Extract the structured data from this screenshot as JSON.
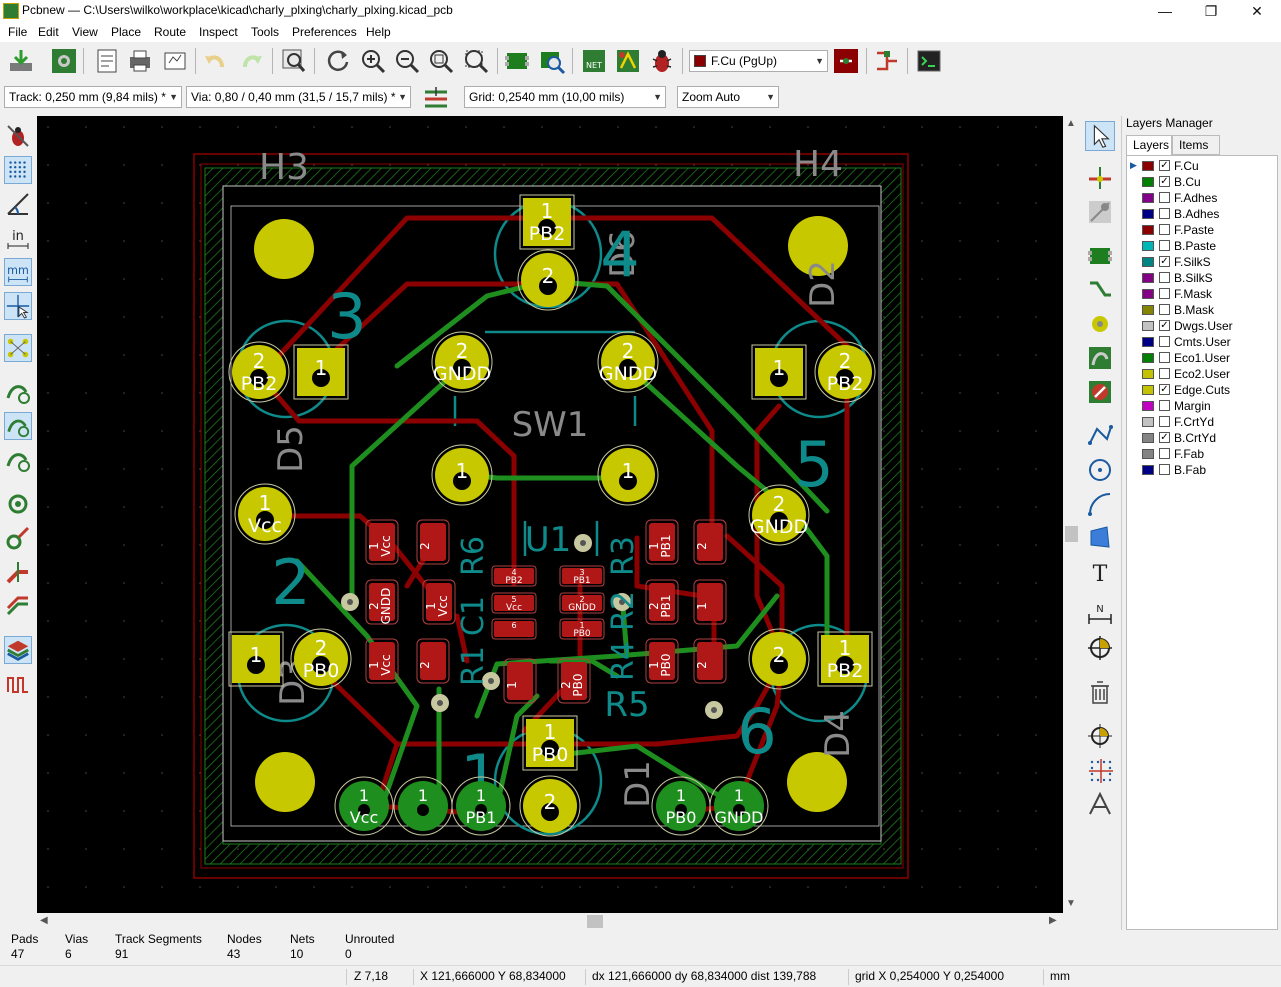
{
  "window": {
    "title": "Pcbnew — C:\\Users\\wilko\\workplace\\kicad\\charly_plxing\\charly_plxing.kicad_pcb",
    "controls": [
      "—",
      "❐",
      "✕"
    ]
  },
  "menu": [
    "File",
    "Edit",
    "View",
    "Place",
    "Route",
    "Inspect",
    "Tools",
    "Preferences",
    "Help"
  ],
  "toolbar": {
    "layer_select": "F.Cu (PgUp)"
  },
  "toolbar2": {
    "track": "Track: 0,250 mm (9,84 mils) *",
    "via": "Via: 0,80 / 0,40 mm (31,5 / 15,7 mils) *",
    "grid": "Grid: 0,2540 mm (10,00 mils)",
    "zoom": "Zoom Auto"
  },
  "layers_manager": {
    "title": "Layers Manager",
    "tabs": [
      "Layers",
      "Items"
    ],
    "layers": [
      {
        "name": "F.Cu",
        "color": "#8b0000",
        "checked": true
      },
      {
        "name": "B.Cu",
        "color": "#008000",
        "checked": true
      },
      {
        "name": "F.Adhes",
        "color": "#84008b",
        "checked": false
      },
      {
        "name": "B.Adhes",
        "color": "#000084",
        "checked": false
      },
      {
        "name": "F.Paste",
        "color": "#8b0000",
        "checked": false
      },
      {
        "name": "B.Paste",
        "color": "#00b5b5",
        "checked": false
      },
      {
        "name": "F.SilkS",
        "color": "#008484",
        "checked": true
      },
      {
        "name": "B.SilkS",
        "color": "#840084",
        "checked": false
      },
      {
        "name": "F.Mask",
        "color": "#840084",
        "checked": false
      },
      {
        "name": "B.Mask",
        "color": "#848400",
        "checked": false
      },
      {
        "name": "Dwgs.User",
        "color": "#c2c2c2",
        "checked": true
      },
      {
        "name": "Cmts.User",
        "color": "#000084",
        "checked": false
      },
      {
        "name": "Eco1.User",
        "color": "#008000",
        "checked": false
      },
      {
        "name": "Eco2.User",
        "color": "#c2c200",
        "checked": false
      },
      {
        "name": "Edge.Cuts",
        "color": "#c2c200",
        "checked": true
      },
      {
        "name": "Margin",
        "color": "#c200c2",
        "checked": false
      },
      {
        "name": "F.CrtYd",
        "color": "#c2c2c2",
        "checked": false
      },
      {
        "name": "B.CrtYd",
        "color": "#848484",
        "checked": true
      },
      {
        "name": "F.Fab",
        "color": "#848484",
        "checked": false
      },
      {
        "name": "B.Fab",
        "color": "#000084",
        "checked": false
      }
    ]
  },
  "board": {
    "labels": {
      "h3": "H3",
      "h4": "H4",
      "sw1": "SW1",
      "u1": "U1",
      "r5": "R5",
      "d1": "D1",
      "d2": "D2",
      "d3": "D3",
      "d4": "D4",
      "d5": "D5",
      "d6": "D6",
      "n1": "1",
      "n2": "2",
      "n3": "3",
      "n4": "4",
      "n5": "5",
      "n6": "6",
      "r1": "R1",
      "r2": "R2",
      "r3": "R3",
      "r4": "R4",
      "r6": "R6",
      "c1": "C1"
    },
    "big_pads": [
      {
        "num": "1",
        "net": "PB2"
      },
      {
        "num": "2",
        "net": ""
      },
      {
        "num": "2",
        "net": "PB2"
      },
      {
        "num": "1",
        "net": ""
      },
      {
        "num": "2",
        "net": "GNDD"
      },
      {
        "num": "2",
        "net": "GNDD"
      },
      {
        "num": "1",
        "net": ""
      },
      {
        "num": "2",
        "net": "PB2"
      },
      {
        "num": "1",
        "net": ""
      },
      {
        "num": "1",
        "net": ""
      },
      {
        "num": "1",
        "net": "Vcc"
      },
      {
        "num": "2",
        "net": "GNDD"
      },
      {
        "num": "1",
        "net": ""
      },
      {
        "num": "2",
        "net": "PB0"
      },
      {
        "num": "2",
        "net": ""
      },
      {
        "num": "1",
        "net": "PB2"
      },
      {
        "num": "1",
        "net": "PB0"
      },
      {
        "num": "2",
        "net": ""
      }
    ],
    "conn_pads": [
      {
        "num": "1",
        "net": "Vcc"
      },
      {
        "num": "1",
        "net": ""
      },
      {
        "num": "1",
        "net": "PB1"
      },
      {
        "num": "1",
        "net": "PB0"
      },
      {
        "num": "1",
        "net": "GNDD"
      }
    ],
    "smd_pads": [
      {
        "num": "1",
        "net": "Vcc"
      },
      {
        "num": "2",
        "net": ""
      },
      {
        "num": "2",
        "net": "GNDD"
      },
      {
        "num": "1",
        "net": "Vcc"
      },
      {
        "num": "1",
        "net": "Vcc"
      },
      {
        "num": "2",
        "net": ""
      },
      {
        "num": "1",
        "net": "PB1"
      },
      {
        "num": "2",
        "net": ""
      },
      {
        "num": "2",
        "net": "PB1"
      },
      {
        "num": "1",
        "net": ""
      },
      {
        "num": "1",
        "net": "PB0"
      },
      {
        "num": "2",
        "net": ""
      },
      {
        "num": "1",
        "net": ""
      },
      {
        "num": "2",
        "net": "PB0"
      }
    ],
    "u1_pads": [
      {
        "num": "4",
        "net": "PB2"
      },
      {
        "num": "5",
        "net": "Vcc"
      },
      {
        "num": "6",
        "net": ""
      },
      {
        "num": "3",
        "net": "PB1"
      },
      {
        "num": "2",
        "net": "GNDD"
      },
      {
        "num": "1",
        "net": "PB0"
      }
    ]
  },
  "stats": [
    {
      "label": "Pads",
      "value": "47"
    },
    {
      "label": "Vias",
      "value": "6"
    },
    {
      "label": "Track Segments",
      "value": "91"
    },
    {
      "label": "Nodes",
      "value": "43"
    },
    {
      "label": "Nets",
      "value": "10"
    },
    {
      "label": "Unrouted",
      "value": "0"
    }
  ],
  "statusbar": {
    "zoom": "Z 7,18",
    "xy": "X 121,666000  Y 68,834000",
    "delta": "dx 121,666000  dy 68,834000  dist 139,788",
    "grid": "grid X 0,254000  Y 0,254000",
    "units": "mm"
  }
}
